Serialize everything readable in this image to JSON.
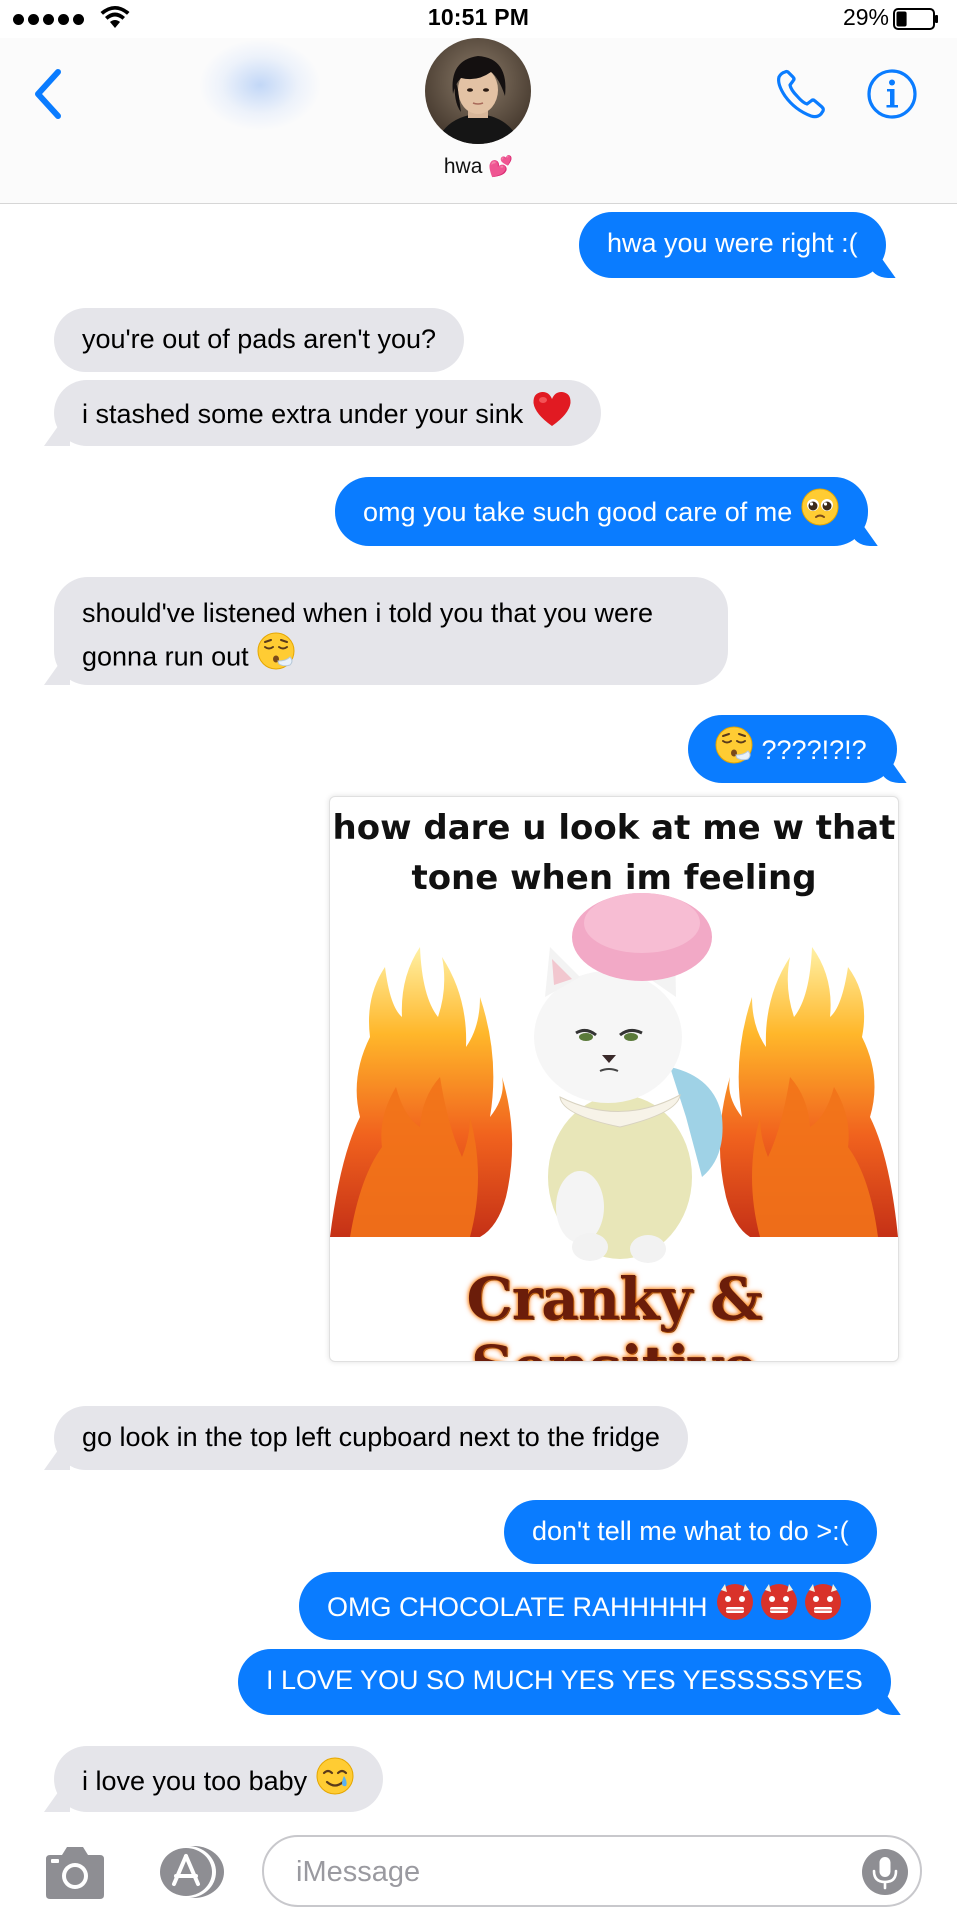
{
  "status_bar": {
    "time": "10:51 PM",
    "battery_percent": "29%",
    "battery_level": 0.29
  },
  "header": {
    "contact_name": "hwa",
    "contact_emoji": "💕",
    "icons": [
      "chevron-left-icon",
      "phone-icon",
      "info-icon"
    ],
    "accent_color": "#0a7cff"
  },
  "messages": [
    {
      "from": "me",
      "text": "hwa you were right :("
    },
    {
      "from": "hwa",
      "text": "you're out of pads aren't you?"
    },
    {
      "from": "hwa",
      "text": "i stashed some extra under your sink",
      "emoji": "❤️"
    },
    {
      "from": "me",
      "text": "omg you take such good care of me",
      "emoji": "🥺"
    },
    {
      "from": "hwa",
      "text": "should've listened when i told you that you were gonna run out",
      "emoji": "😮‍💨"
    },
    {
      "from": "me",
      "emoji": "😮‍💨",
      "text": "????!?!?"
    },
    {
      "from": "me",
      "type": "image",
      "caption": "how dare u look at me w that tone when im feeling",
      "footer": "Cranky & Sensitive"
    },
    {
      "from": "hwa",
      "text": "go look in the top left cupboard next to the fridge"
    },
    {
      "from": "me",
      "text": "don't tell me what to do >:("
    },
    {
      "from": "me",
      "text": "OMG CHOCOLATE RAHHHHH",
      "emoji": "👹👹👹"
    },
    {
      "from": "me",
      "text": "I LOVE YOU SO MUCH YES YES YESSSSSYES"
    },
    {
      "from": "hwa",
      "text": "i love you too baby",
      "emoji": "🥲"
    }
  ],
  "input_bar": {
    "placeholder": "iMessage",
    "value": "",
    "icons": [
      "camera-icon",
      "app-store-icon",
      "microphone-icon"
    ]
  },
  "colors": {
    "outgoing_bubble": "#0a7cff",
    "incoming_bubble": "#e5e5ea"
  }
}
